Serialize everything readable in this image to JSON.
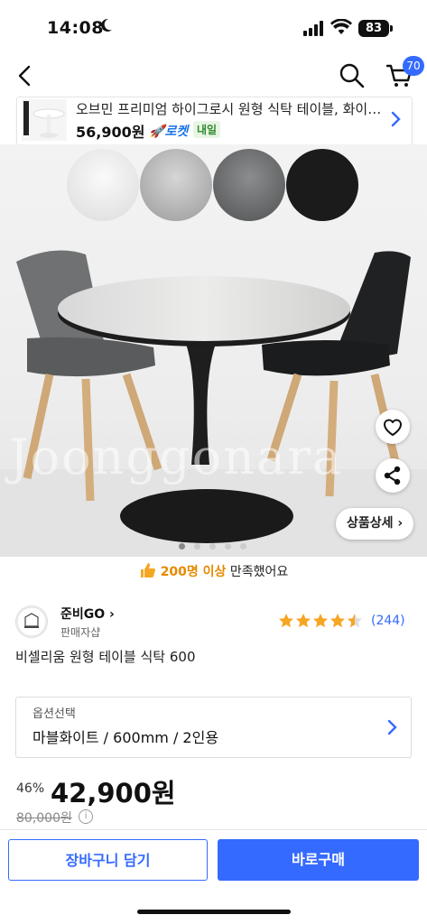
{
  "status_bar": {
    "time": "14:08",
    "battery": "83"
  },
  "header": {
    "cart_count": "70"
  },
  "mini_banner": {
    "title": "오브민 프리미엄 하이그로시 원형 식탁 테이블, 화이트, ...",
    "price": "56,900원",
    "rocket_label": "로켓",
    "delivery_label": "내일"
  },
  "swatches": [
    {
      "name": "white",
      "color": "#f4f4f2"
    },
    {
      "name": "light-marble",
      "color": "#c9c9c9"
    },
    {
      "name": "dark-marble",
      "color": "#7e7f80"
    },
    {
      "name": "black",
      "color": "#1a1a1a"
    }
  ],
  "hero": {
    "watermark": "Joonggonara",
    "detail_button": "상품상세",
    "carousel_total": 5,
    "carousel_active": 1
  },
  "satisfaction": {
    "highlight": "200명 이상",
    "rest": " 만족했어요"
  },
  "seller": {
    "name": "준비GO",
    "sub": "판매자샵"
  },
  "rating": {
    "stars": 4.5,
    "count": "(244)",
    "star_color": "#f6a623"
  },
  "product": {
    "title": "비셀리움 원형 테이블 식탁 600"
  },
  "option": {
    "label": "옵션선택",
    "value": "마블화이트 / 600mm / 2인용"
  },
  "price": {
    "discount": "46%",
    "sale": "42,900원",
    "original": "80,000원"
  },
  "actions": {
    "cart": "장바구니 담기",
    "buy": "바로구매"
  },
  "colors": {
    "accent": "#346aff",
    "highlight": "#e58a00"
  }
}
